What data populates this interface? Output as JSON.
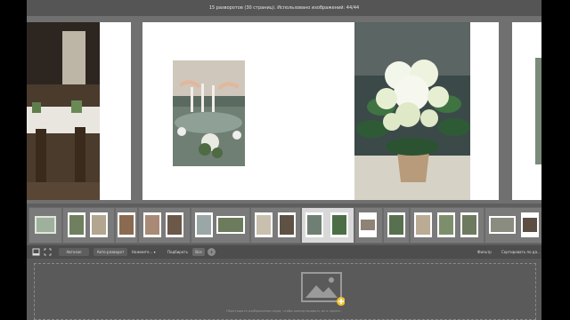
{
  "topbar": {
    "status": "15 разворотов (30 страниц). Использовано изображений: 44/44"
  },
  "toolbar": {
    "autofill_label": "Автозап",
    "autoflip_label": "Авто-разворот",
    "hint_label": "Нажмите...",
    "fit_label": "Подбирать",
    "all_label": "Все",
    "add_label": "+",
    "filter_label": "Фильтр",
    "sort_label": "Сортировать по да..."
  },
  "dropzone": {
    "hint": "Перетащите изображения сюда, чтобы импортировать их в проект."
  },
  "filmstrip": {
    "selected_index": 5
  }
}
